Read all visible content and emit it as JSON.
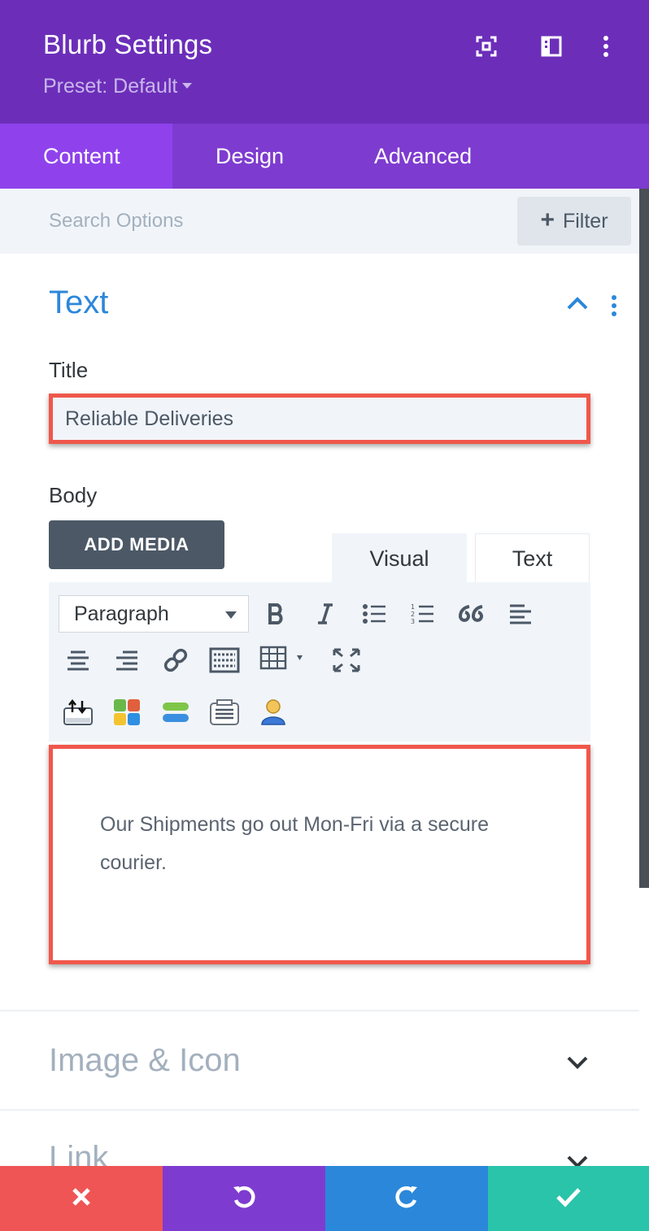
{
  "header": {
    "title": "Blurb Settings",
    "preset_label": "Preset: Default",
    "icons": [
      "fullscreen-icon",
      "sidebar-layout-icon",
      "more-vertical-icon"
    ],
    "background_color": "#6c2eb9"
  },
  "tabs": [
    {
      "label": "Content",
      "active": true
    },
    {
      "label": "Design",
      "active": false
    },
    {
      "label": "Advanced",
      "active": false
    }
  ],
  "search": {
    "placeholder": "Search Options",
    "filter_label": "Filter"
  },
  "text_section": {
    "title": "Text",
    "title_field": {
      "label": "Title",
      "value": "Reliable Deliveries"
    },
    "body_field": {
      "label": "Body",
      "add_media_label": "ADD MEDIA",
      "editor_tabs": [
        "Visual",
        "Text"
      ],
      "active_editor_tab": "Visual",
      "format_select": "Paragraph",
      "toolbar_icons": [
        "bold-icon",
        "italic-icon",
        "bulleted-list-icon",
        "numbered-list-icon",
        "blockquote-icon",
        "align-left-icon",
        "align-center-icon",
        "align-right-icon",
        "link-icon",
        "keyboard-shortcuts-icon",
        "table-icon",
        "fullscreen-icon",
        "import-icon",
        "color-blocks-icon",
        "toggle-icon",
        "text-block-icon",
        "person-icon"
      ],
      "content": "Our Shipments go out Mon-Fri via a secure courier."
    }
  },
  "collapsed_sections": [
    {
      "title": "Image & Icon"
    },
    {
      "title": "Link"
    }
  ],
  "bottom_bar": {
    "buttons": [
      {
        "name": "cancel",
        "icon": "close-icon",
        "color": "#ef5555"
      },
      {
        "name": "undo",
        "icon": "undo-icon",
        "color": "#7e3bd0"
      },
      {
        "name": "redo",
        "icon": "redo-icon",
        "color": "#2b87da"
      },
      {
        "name": "save",
        "icon": "check-icon",
        "color": "#29c4a9"
      }
    ]
  },
  "highlight_color": "#f0574b",
  "accent_color": "#2b87da"
}
